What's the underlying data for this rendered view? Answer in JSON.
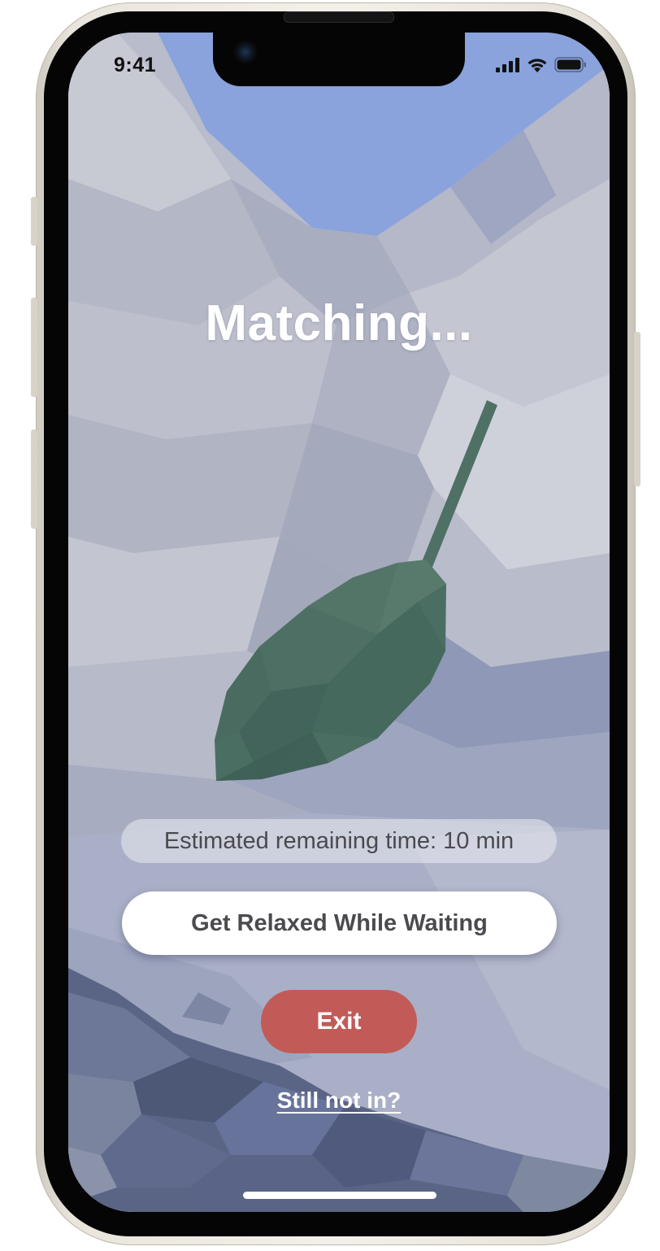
{
  "status_bar": {
    "time": "9:41"
  },
  "matching": {
    "title": "Matching...",
    "estimate_text": "Estimated remaining time: 10 min"
  },
  "actions": {
    "relax_label": "Get Relaxed While Waiting",
    "exit_label": "Exit",
    "still_not_in_label": "Still not in?"
  },
  "colors": {
    "exit_button": "#c25b58",
    "leaf": "#4b6e62",
    "sky": "#8aa3dd"
  },
  "icons": [
    "cellular-signal-icon",
    "wifi-icon",
    "battery-icon",
    "leaf-illustration"
  ]
}
